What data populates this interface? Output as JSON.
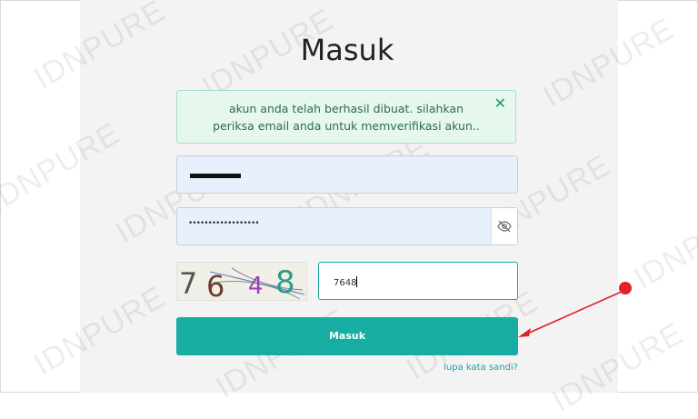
{
  "page": {
    "title": "Masuk"
  },
  "alert": {
    "message": "akun anda telah berhasil dibuat. silahkan periksa email anda untuk memverifikasi akun..",
    "close_icon": "close-icon"
  },
  "form": {
    "password_mask": "••••••••••••••••••",
    "captcha_digits": [
      "7",
      "6",
      "4",
      "8"
    ],
    "captcha_value": "7648",
    "submit_label": "Masuk",
    "forgot_label": "lupa kata sandi?"
  },
  "watermark": "IDNPURE",
  "colors": {
    "accent": "#17ada3",
    "alert_bg": "#e6f7ee",
    "annotation": "#e0202a"
  }
}
